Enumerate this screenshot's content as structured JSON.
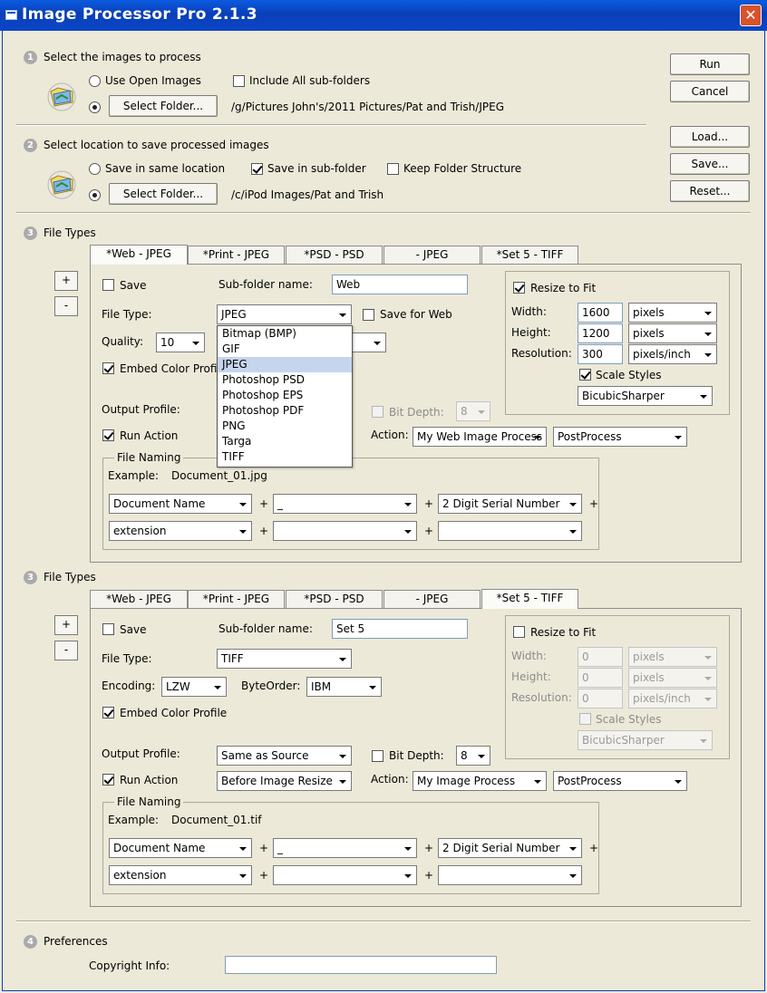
{
  "window": {
    "title": "Image Processor Pro 2.1.3",
    "close_glyph": "✕"
  },
  "side_buttons": {
    "run": "Run",
    "cancel": "Cancel",
    "load": "Load...",
    "save": "Save...",
    "reset": "Reset..."
  },
  "section1": {
    "number": "1",
    "title": "Select the images to process",
    "use_open_images": "Use Open Images",
    "use_open_images_checked": false,
    "include_subfolders": "Include All sub-folders",
    "include_subfolders_checked": false,
    "select_folder": "Select Folder...",
    "folder_selected": true,
    "folder_path": "/g/Pictures John's/2011 Pictures/Pat and Trish/JPEG"
  },
  "section2": {
    "number": "2",
    "title": "Select location to save processed images",
    "save_same_location": "Save in same location",
    "save_in_subfolder": "Save in sub-folder",
    "save_in_subfolder_checked": true,
    "keep_folder_structure": "Keep Folder Structure",
    "keep_folder_structure_checked": false,
    "select_folder": "Select Folder...",
    "folder_path": "/c/iPod Images/Pat and Trish"
  },
  "tabs": [
    "*Web - JPEG",
    "*Print - JPEG",
    "*PSD - PSD",
    "- JPEG",
    "*Set 5 - TIFF"
  ],
  "filetypes_a": {
    "number": "3",
    "title": "File Types",
    "active_tab": "*Web - JPEG",
    "add": "+",
    "remove": "-",
    "save_label": "Save",
    "save_checked": false,
    "subfolder_label": "Sub-folder name:",
    "subfolder_value": "Web",
    "filetype_label": "File Type:",
    "filetype_value": "JPEG",
    "save_for_web": "Save for Web",
    "save_for_web_checked": false,
    "quality_label": "Quality:",
    "quality_value": "10",
    "embed_profile": "Embed Color Profile",
    "embed_profile_checked": true,
    "output_profile_label": "Output Profile:",
    "bit_depth_label": "Bit Depth:",
    "bit_depth_value": "8",
    "run_action": "Run Action",
    "run_action_checked": true,
    "action_label": "Action:",
    "action_value": "My Web Image Process",
    "action_set": "PostProcess",
    "dropdown_options": [
      "Bitmap (BMP)",
      "GIF",
      "JPEG",
      "Photoshop PSD",
      "Photoshop EPS",
      "Photoshop PDF",
      "PNG",
      "Targa",
      "TIFF"
    ],
    "dropdown_highlight": "JPEG",
    "resize": {
      "label": "Resize to Fit",
      "checked": true,
      "width_label": "Width:",
      "width": "1600",
      "width_unit": "pixels",
      "height_label": "Height:",
      "height": "1200",
      "height_unit": "pixels",
      "res_label": "Resolution:",
      "resolution": "300",
      "res_unit": "pixels/inch",
      "scale_styles": "Scale Styles",
      "scale_checked": true,
      "resample": "BicubicSharper"
    },
    "naming": {
      "title": "File Naming",
      "example_label": "Example:",
      "example": "Document_01.jpg",
      "r1c1": "Document Name",
      "r1c2": "_",
      "r1c3": "2 Digit Serial Number",
      "r2c1": "extension",
      "r2c2": "",
      "r2c3": ""
    }
  },
  "filetypes_b": {
    "number": "3",
    "title": "File Types",
    "active_tab": "*Set 5 - TIFF",
    "add": "+",
    "remove": "-",
    "save_label": "Save",
    "save_checked": false,
    "subfolder_label": "Sub-folder name:",
    "subfolder_value": "Set 5",
    "filetype_label": "File Type:",
    "filetype_value": "TIFF",
    "encoding_label": "Encoding:",
    "encoding_value": "LZW",
    "byteorder_label": "ByteOrder:",
    "byteorder_value": "IBM",
    "embed_profile": "Embed Color Profile",
    "embed_profile_checked": true,
    "output_profile_label": "Output Profile:",
    "output_profile_value": "Same as Source",
    "bit_depth_label": "Bit Depth:",
    "bit_depth_value": "8",
    "run_action": "Run Action",
    "run_action_checked": true,
    "run_action_when": "Before Image Resize",
    "action_label": "Action:",
    "action_value": "My Image Process",
    "action_set": "PostProcess",
    "resize": {
      "label": "Resize to Fit",
      "checked": false,
      "width_label": "Width:",
      "width": "0",
      "width_unit": "pixels",
      "height_label": "Height:",
      "height": "0",
      "height_unit": "pixels",
      "res_label": "Resolution:",
      "resolution": "0",
      "res_unit": "pixels/inch",
      "scale_styles": "Scale Styles",
      "scale_checked": false,
      "resample": "BicubicSharper"
    },
    "naming": {
      "title": "File Naming",
      "example_label": "Example:",
      "example": "Document_01.tif",
      "r1c1": "Document Name",
      "r1c2": "_",
      "r1c3": "2 Digit Serial Number",
      "r2c1": "extension",
      "r2c2": "",
      "r2c3": ""
    }
  },
  "preferences": {
    "number": "4",
    "title": "Preferences",
    "copyright_label": "Copyright Info:",
    "copyright_value": ""
  },
  "colors": {
    "titlebar": "#0a46c8",
    "window_bg": "#ece9d8",
    "highlight": "#c5d5ee",
    "close": "#d9522b"
  }
}
